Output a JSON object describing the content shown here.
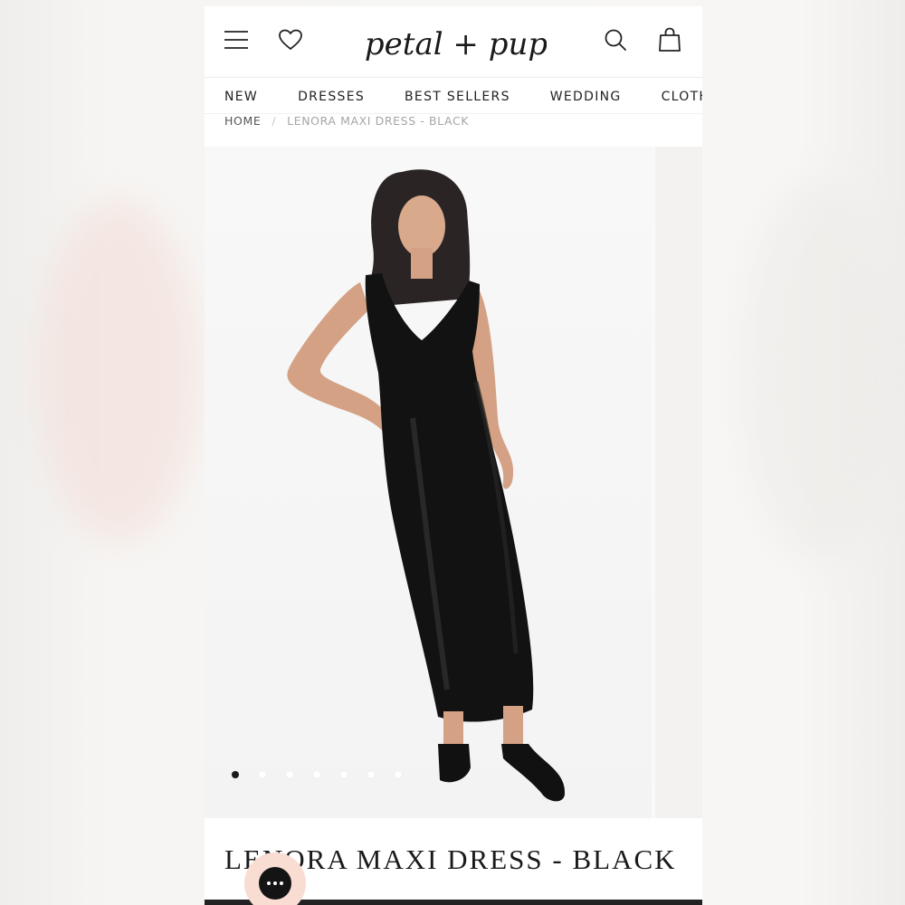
{
  "header": {
    "logo_text": "petal + pup",
    "icons": [
      "menu-icon",
      "heart-icon",
      "search-icon",
      "bag-icon"
    ]
  },
  "nav": {
    "items": [
      "NEW",
      "DRESSES",
      "BEST SELLERS",
      "WEDDING",
      "CLOTHING"
    ]
  },
  "breadcrumb": {
    "home": "HOME",
    "separator": "/",
    "current": "LENORA MAXI DRESS - BLACK"
  },
  "gallery": {
    "image_count": 7,
    "active_index": 0
  },
  "product": {
    "title": "LENORA MAXI DRESS - BLACK"
  },
  "colors": {
    "text": "#1a1a1a",
    "chat_bg": "#f9dcd2",
    "chat_icon": "#141414"
  }
}
